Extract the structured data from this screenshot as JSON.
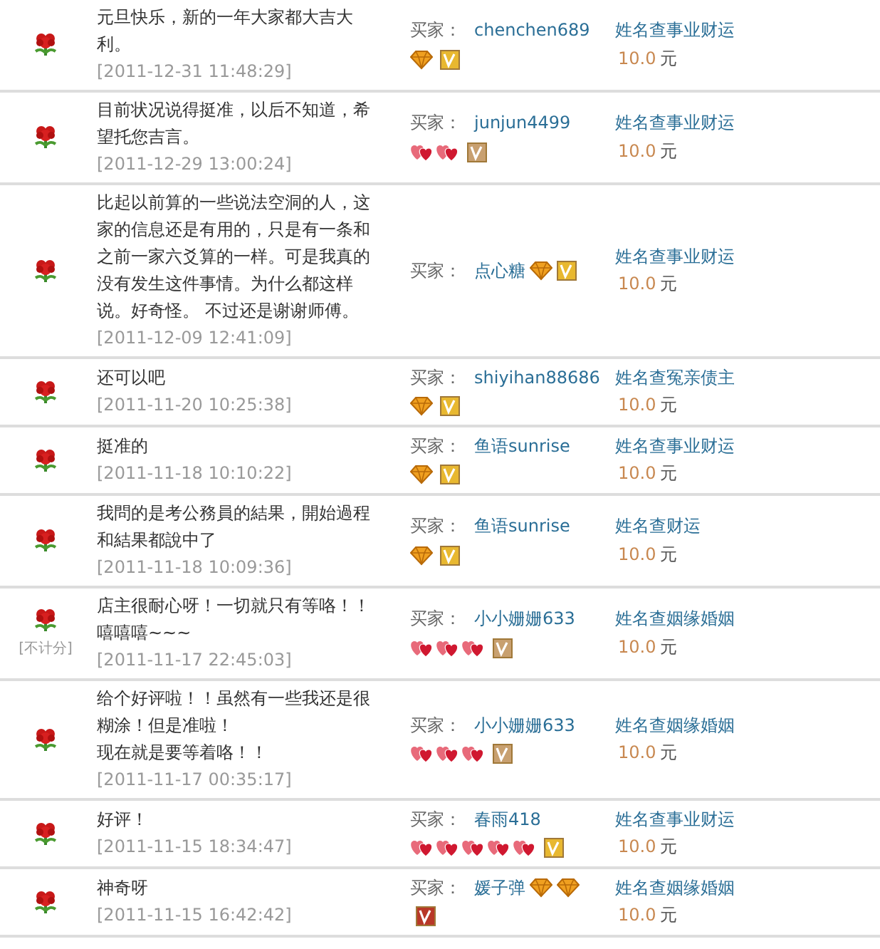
{
  "reviews": [
    {
      "positive": true,
      "paragraphs": [
        "元旦快乐，新的一年大家都大吉大利。"
      ],
      "date": "[2011-12-31 11:48:29]",
      "buyer_label": "买家：",
      "buyer": "chenchen689",
      "badges": [
        {
          "kind": "diamond"
        },
        {
          "kind": "vip",
          "color": "#e8b830"
        }
      ],
      "product": "姓名查事业财运",
      "price": "10.0",
      "currency": "元"
    },
    {
      "positive": true,
      "paragraphs": [
        "目前状况说得挺准，以后不知道，希望托您吉言。"
      ],
      "date": "[2011-12-29 13:00:24]",
      "buyer_label": "买家：",
      "buyer": "junjun4499",
      "badges": [
        {
          "kind": "heart"
        },
        {
          "kind": "heart"
        },
        {
          "kind": "vip",
          "color": "#c8a070"
        }
      ],
      "product": "姓名查事业财运",
      "price": "10.0",
      "currency": "元"
    },
    {
      "positive": true,
      "paragraphs": [
        "比起以前算的一些说法空洞的人，这家的信息还是有用的，只是有一条和之前一家六爻算的一样。可是我真的没有发生这件事情。为什么都这样说。好奇怪。 不过还是谢谢师傅。"
      ],
      "date": "[2011-12-09 12:41:09]",
      "buyer_label": "买家：",
      "buyer": "点心糖",
      "name_badges": [
        {
          "kind": "diamond"
        },
        {
          "kind": "vip",
          "color": "#e8b830"
        }
      ],
      "product": "姓名查事业财运",
      "price": "10.0",
      "currency": "元"
    },
    {
      "positive": true,
      "paragraphs": [
        "还可以吧"
      ],
      "date": "[2011-11-20 10:25:38]",
      "buyer_label": "买家：",
      "buyer": "shiyihan88686",
      "badges": [
        {
          "kind": "diamond"
        },
        {
          "kind": "vip",
          "color": "#e8b830"
        }
      ],
      "product": "姓名查冤亲债主",
      "price": "10.0",
      "currency": "元"
    },
    {
      "positive": true,
      "paragraphs": [
        "挺准的"
      ],
      "date": "[2011-11-18 10:10:22]",
      "buyer_label": "买家：",
      "buyer": "鱼语sunrise",
      "badges": [
        {
          "kind": "diamond"
        },
        {
          "kind": "vip",
          "color": "#e8b830"
        }
      ],
      "product": "姓名查事业财运",
      "price": "10.0",
      "currency": "元"
    },
    {
      "positive": true,
      "paragraphs": [
        "我問的是考公務員的結果，開始過程和結果都說中了"
      ],
      "date": "[2011-11-18 10:09:36]",
      "buyer_label": "买家：",
      "buyer": "鱼语sunrise",
      "badges": [
        {
          "kind": "diamond"
        },
        {
          "kind": "vip",
          "color": "#e8b830"
        }
      ],
      "product": "姓名查财运",
      "price": "10.0",
      "currency": "元"
    },
    {
      "positive": true,
      "note": "[不计分]",
      "paragraphs": [
        "店主很耐心呀！一切就只有等咯！！嘻嘻嘻~~~"
      ],
      "date": "[2011-11-17 22:45:03]",
      "buyer_label": "买家：",
      "buyer": "小小姗姗633",
      "badges": [
        {
          "kind": "heart"
        },
        {
          "kind": "heart"
        },
        {
          "kind": "heart"
        },
        {
          "kind": "vip",
          "color": "#c8a070"
        }
      ],
      "product": "姓名查姻缘婚姻",
      "price": "10.0",
      "currency": "元"
    },
    {
      "positive": true,
      "paragraphs": [
        "给个好评啦！！虽然有一些我还是很糊涂！但是准啦！",
        "现在就是要等着咯！！"
      ],
      "date": "[2011-11-17 00:35:17]",
      "buyer_label": "买家：",
      "buyer": "小小姗姗633",
      "badges": [
        {
          "kind": "heart"
        },
        {
          "kind": "heart"
        },
        {
          "kind": "heart"
        },
        {
          "kind": "vip",
          "color": "#c8a070"
        }
      ],
      "product": "姓名查姻缘婚姻",
      "price": "10.0",
      "currency": "元"
    },
    {
      "positive": true,
      "paragraphs": [
        "好评！"
      ],
      "date": "[2011-11-15 18:34:47]",
      "buyer_label": "买家：",
      "buyer": "春雨418",
      "badges": [
        {
          "kind": "heart"
        },
        {
          "kind": "heart"
        },
        {
          "kind": "heart"
        },
        {
          "kind": "heart"
        },
        {
          "kind": "heart"
        },
        {
          "kind": "vip",
          "color": "#e8b830"
        }
      ],
      "product": "姓名查事业财运",
      "price": "10.0",
      "currency": "元"
    },
    {
      "positive": true,
      "paragraphs": [
        "神奇呀"
      ],
      "date": "[2011-11-15 16:42:42]",
      "buyer_label": "买家：",
      "buyer": "媛子弹",
      "name_badges": [
        {
          "kind": "diamond"
        },
        {
          "kind": "diamond"
        }
      ],
      "badges": [
        {
          "kind": "vip",
          "color": "#b83828"
        }
      ],
      "product": "姓名查姻缘婚姻",
      "price": "10.0",
      "currency": "元"
    }
  ]
}
